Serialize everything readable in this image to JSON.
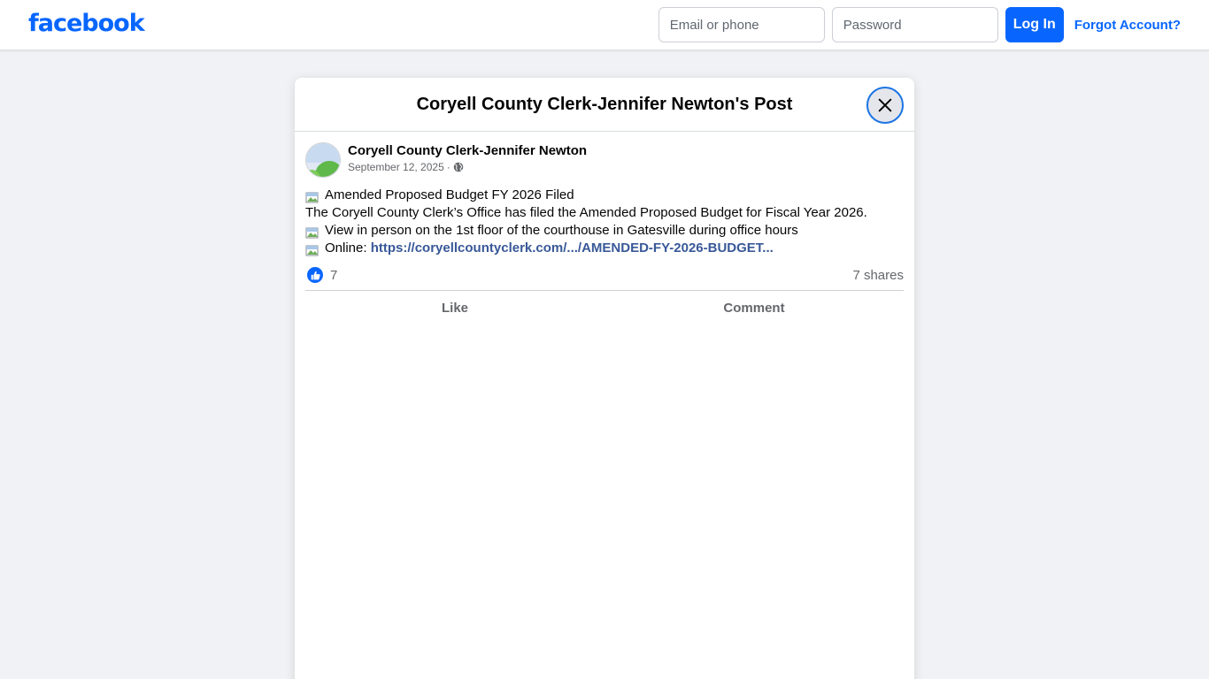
{
  "header": {
    "logo": "facebook",
    "email_placeholder": "Email or phone",
    "password_placeholder": "Password",
    "login_label": "Log In",
    "forgot_label": "Forgot Account?"
  },
  "modal": {
    "title": "Coryell County Clerk-Jennifer Newton's Post",
    "close_icon": "close-icon"
  },
  "post": {
    "author": "Coryell County Clerk-Jennifer Newton",
    "date": "September 12, 2025",
    "separator": "·",
    "privacy_icon": "globe-icon",
    "lines": [
      "Amended Proposed Budget FY 2026 Filed",
      "The Coryell County Clerk’s Office has filed the Amended Proposed Budget for Fiscal Year 2026.",
      "View in person on the 1st floor of the courthouse in Gatesville during office hours",
      "Online: "
    ],
    "link_text": "https://coryellcountyclerk.com/.../AMENDED-FY-2026-BUDGET...",
    "reaction_count": "7",
    "shares": "7 shares",
    "like_label": "Like",
    "comment_label": "Comment"
  },
  "colors": {
    "brand": "#0866ff",
    "link": "#385898",
    "page_bg": "#f0f2f5"
  }
}
